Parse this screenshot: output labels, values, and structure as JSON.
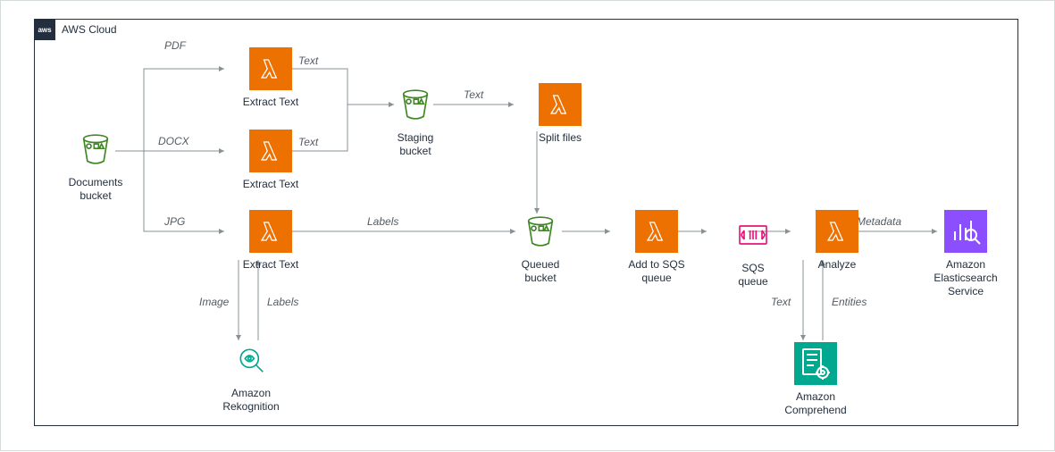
{
  "cloud_title": "AWS Cloud",
  "cloud_badge": "aws",
  "nodes": {
    "documents_bucket": "Documents\nbucket",
    "extract_text_pdf": "Extract Text",
    "extract_text_docx": "Extract Text",
    "extract_text_jpg": "Extract Text",
    "staging_bucket": "Staging\nbucket",
    "split_files": "Split files",
    "queued_bucket": "Queued\nbucket",
    "add_to_sqs": "Add to SQS\nqueue",
    "sqs_queue": "SQS\nqueue",
    "analyze": "Analyze",
    "elasticsearch": "Amazon\nElasticsearch\nService",
    "rekognition": "Amazon\nRekognition",
    "comprehend": "Amazon\nComprehend"
  },
  "edges": {
    "pdf": "PDF",
    "docx": "DOCX",
    "jpg": "JPG",
    "text1": "Text",
    "text2": "Text",
    "text3": "Text",
    "labels1": "Labels",
    "image": "Image",
    "labels2": "Labels",
    "metadata": "Metadata",
    "text_down": "Text",
    "entities": "Entities"
  },
  "chart_data": {
    "type": "diagram",
    "title": "AWS Cloud",
    "nodes": [
      {
        "id": "documents_bucket",
        "label": "Documents bucket",
        "service": "S3 bucket"
      },
      {
        "id": "extract_text_pdf",
        "label": "Extract Text",
        "service": "Lambda"
      },
      {
        "id": "extract_text_docx",
        "label": "Extract Text",
        "service": "Lambda"
      },
      {
        "id": "extract_text_jpg",
        "label": "Extract Text",
        "service": "Lambda"
      },
      {
        "id": "staging_bucket",
        "label": "Staging bucket",
        "service": "S3 bucket"
      },
      {
        "id": "split_files",
        "label": "Split files",
        "service": "Lambda"
      },
      {
        "id": "queued_bucket",
        "label": "Queued bucket",
        "service": "S3 bucket"
      },
      {
        "id": "add_to_sqs",
        "label": "Add to SQS queue",
        "service": "Lambda"
      },
      {
        "id": "sqs_queue",
        "label": "SQS queue",
        "service": "SQS"
      },
      {
        "id": "analyze",
        "label": "Analyze",
        "service": "Lambda"
      },
      {
        "id": "elasticsearch",
        "label": "Amazon Elasticsearch Service",
        "service": "Amazon Elasticsearch Service"
      },
      {
        "id": "rekognition",
        "label": "Amazon Rekognition",
        "service": "Amazon Rekognition"
      },
      {
        "id": "comprehend",
        "label": "Amazon Comprehend",
        "service": "Amazon Comprehend"
      }
    ],
    "edges": [
      {
        "from": "documents_bucket",
        "to": "extract_text_pdf",
        "label": "PDF"
      },
      {
        "from": "documents_bucket",
        "to": "extract_text_docx",
        "label": "DOCX"
      },
      {
        "from": "documents_bucket",
        "to": "extract_text_jpg",
        "label": "JPG"
      },
      {
        "from": "extract_text_pdf",
        "to": "staging_bucket",
        "label": "Text"
      },
      {
        "from": "extract_text_docx",
        "to": "staging_bucket",
        "label": "Text"
      },
      {
        "from": "staging_bucket",
        "to": "split_files",
        "label": "Text"
      },
      {
        "from": "split_files",
        "to": "queued_bucket",
        "label": ""
      },
      {
        "from": "extract_text_jpg",
        "to": "queued_bucket",
        "label": "Labels"
      },
      {
        "from": "extract_text_jpg",
        "to": "rekognition",
        "label": "Image",
        "bidirectional": false
      },
      {
        "from": "rekognition",
        "to": "extract_text_jpg",
        "label": "Labels"
      },
      {
        "from": "queued_bucket",
        "to": "add_to_sqs",
        "label": ""
      },
      {
        "from": "add_to_sqs",
        "to": "sqs_queue",
        "label": ""
      },
      {
        "from": "sqs_queue",
        "to": "analyze",
        "label": ""
      },
      {
        "from": "analyze",
        "to": "elasticsearch",
        "label": "Metadata"
      },
      {
        "from": "analyze",
        "to": "comprehend",
        "label": "Text"
      },
      {
        "from": "comprehend",
        "to": "analyze",
        "label": "Entities"
      }
    ]
  }
}
